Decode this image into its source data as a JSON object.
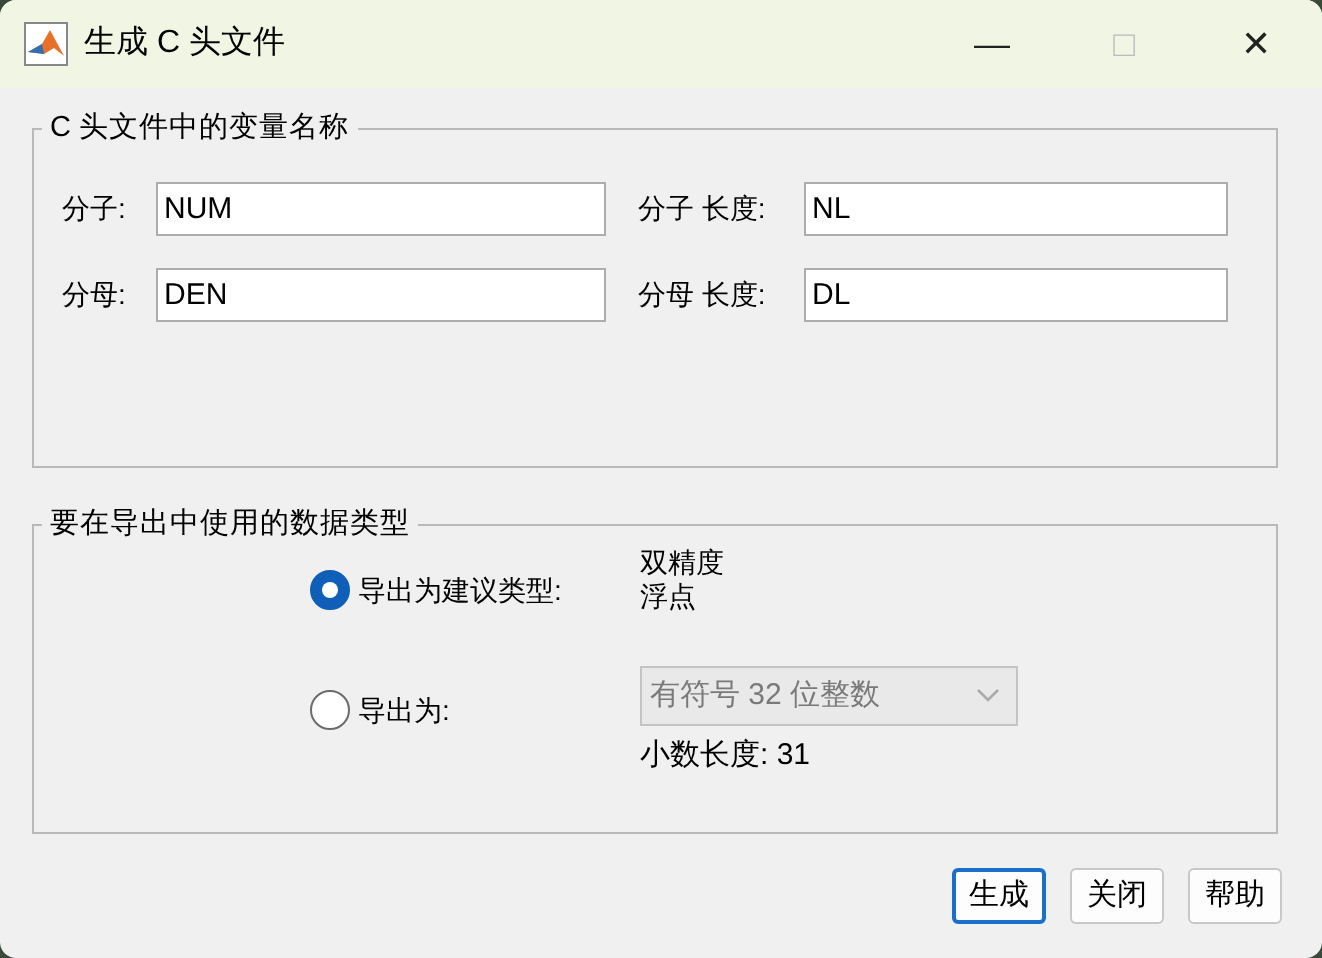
{
  "window": {
    "title": "生成 C 头文件",
    "controls": [
      "—",
      "□",
      "✕"
    ]
  },
  "names_group": {
    "title": "C 头文件中的变量名称",
    "fields": [
      {
        "label": "分子:",
        "value": "NUM"
      },
      {
        "label": "分子 长度:",
        "value": "NL"
      },
      {
        "label": "分母:",
        "value": "DEN"
      },
      {
        "label": "分母 长度:",
        "value": "DL"
      }
    ]
  },
  "type_group": {
    "title": "要在导出中使用的数据类型",
    "options": [
      {
        "kind": "text",
        "label": "导出为建议类型:",
        "selected": true,
        "lines": [
          "双精度",
          "浮点"
        ]
      },
      {
        "kind": "dropdown",
        "label": "导出为:",
        "selected": false,
        "dropdown": {
          "value": "有符号 32 位整数",
          "disabled": true
        },
        "note": "小数长度: 31"
      }
    ]
  },
  "buttons": [
    {
      "label": "生成",
      "default": true
    },
    {
      "label": "关闭",
      "default": false
    },
    {
      "label": "帮助",
      "default": false
    }
  ]
}
